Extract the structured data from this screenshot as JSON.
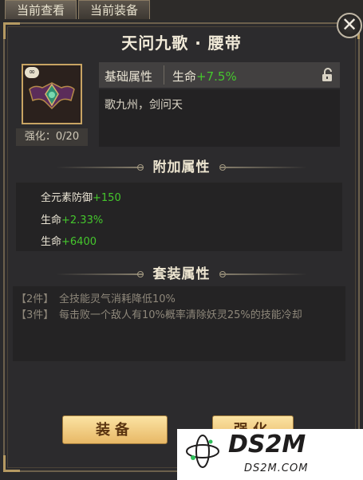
{
  "tabs": [
    {
      "label": "当前查看",
      "active": true
    },
    {
      "label": "当前装备",
      "active": false
    }
  ],
  "close_icon": "close-icon",
  "title": "天问九歌 · 腰带",
  "item": {
    "icon": "belt-icon",
    "badge_icon": "infinity-icon",
    "enhance": "强化：0/20"
  },
  "base_attr": {
    "label": "基础属性",
    "stat_name": "生命",
    "stat_value": "+7.5%",
    "lock_icon": "unlock-icon"
  },
  "description": "歌九州，剑问天",
  "extra_attr": {
    "title": "附加属性",
    "lines": [
      {
        "name": "全元素防御",
        "value": "+150"
      },
      {
        "name": "生命",
        "value": "+2.33%"
      },
      {
        "name": "生命",
        "value": "+6400"
      }
    ]
  },
  "set_attr": {
    "title": "套装属性",
    "lines": [
      {
        "tag": "【2件】",
        "text": "全技能灵气消耗降低10%"
      },
      {
        "tag": "【3件】",
        "text": "每击败一个敌人有10%概率清除妖灵25%的技能冷却"
      }
    ]
  },
  "buttons": {
    "equip": "装备",
    "second": "强化"
  },
  "watermark": {
    "main": "DS2M",
    "sub": "DS2M.COM"
  },
  "colors": {
    "accent_green": "#45c72d",
    "button_gold": "#f0c778",
    "frame_gold": "#c8a463"
  }
}
